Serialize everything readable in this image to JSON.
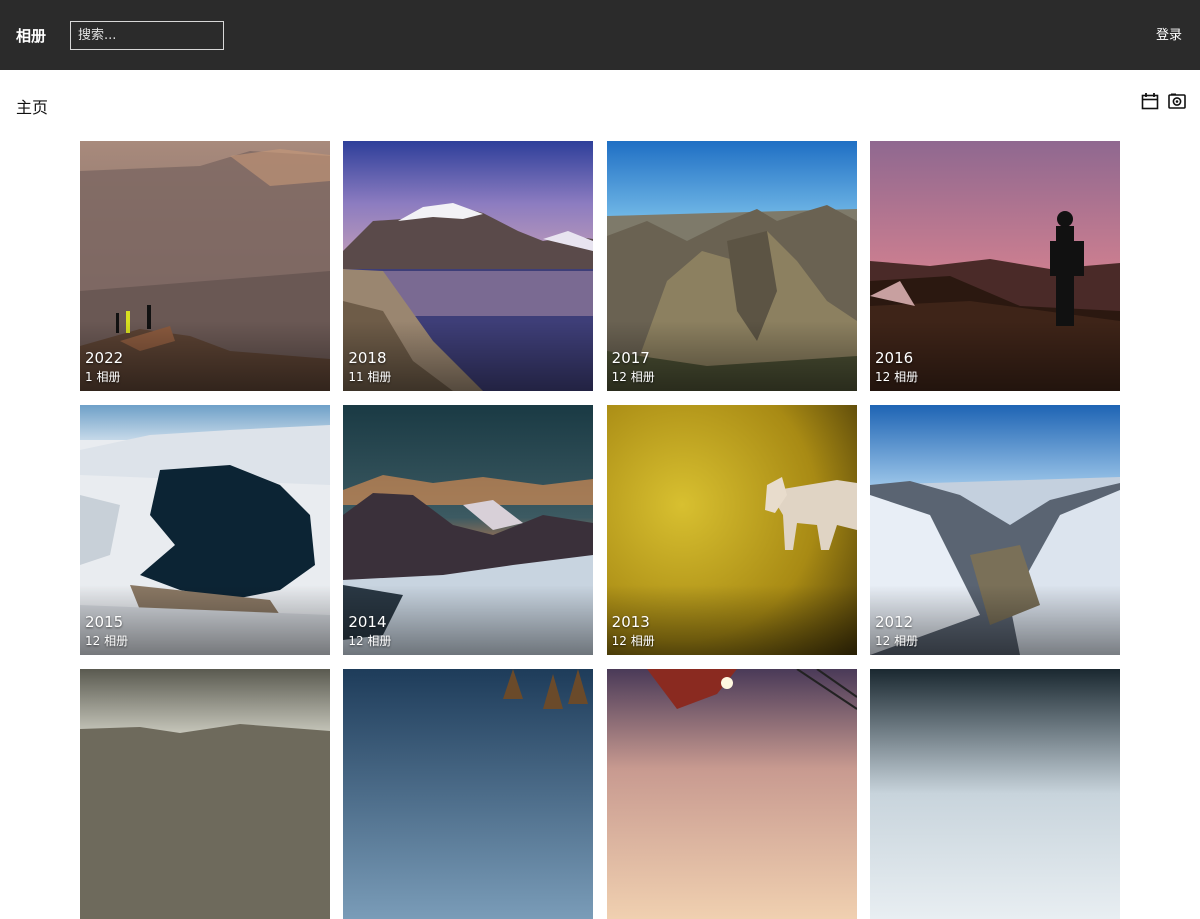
{
  "header": {
    "brand": "相册",
    "search_placeholder": "搜索...",
    "login": "登录"
  },
  "crumb": {
    "title": "主页"
  },
  "toolbar": {
    "icons": [
      "calendar-icon",
      "photo-icon"
    ]
  },
  "albums": [
    {
      "year": "2022",
      "count": "1 相册"
    },
    {
      "year": "2018",
      "count": "11 相册"
    },
    {
      "year": "2017",
      "count": "12 相册"
    },
    {
      "year": "2016",
      "count": "12 相册"
    },
    {
      "year": "2015",
      "count": "12 相册"
    },
    {
      "year": "2014",
      "count": "12 相册"
    },
    {
      "year": "2013",
      "count": "12 相册"
    },
    {
      "year": "2012",
      "count": "12 相册"
    },
    {
      "year": "",
      "count": ""
    },
    {
      "year": "",
      "count": ""
    },
    {
      "year": "",
      "count": ""
    },
    {
      "year": "",
      "count": ""
    }
  ],
  "colors": {
    "topbar": "#2b2b2b",
    "page_bg": "#ffffff"
  }
}
